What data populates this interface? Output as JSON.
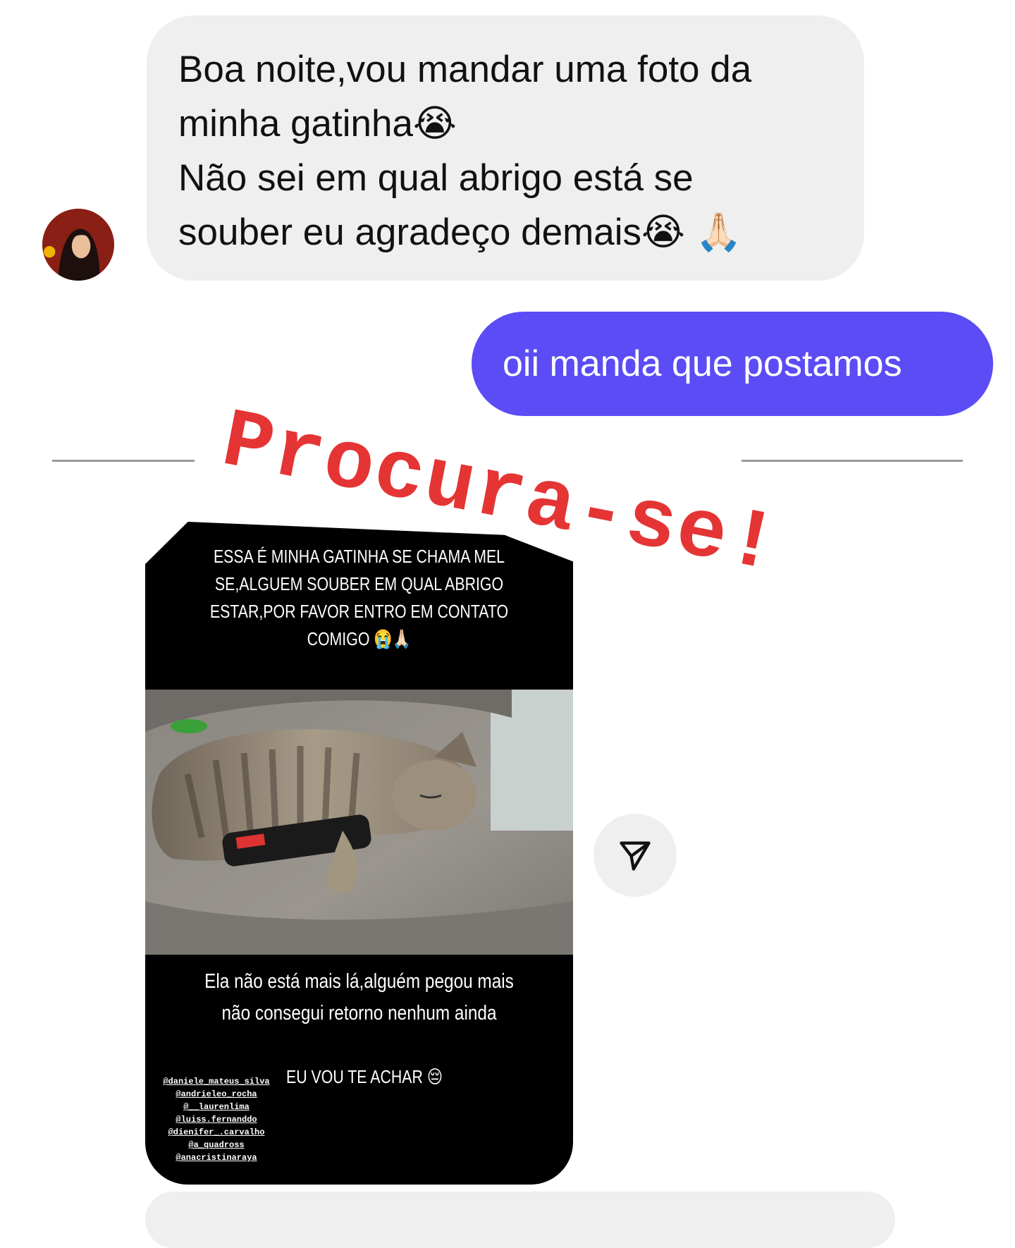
{
  "incoming_message": {
    "text": "Boa noite,vou mandar uma foto da\nminha gatinha😭\nNão sei em qual abrigo está se\nsouber eu agradeço demais😭 🙏🏻"
  },
  "outgoing_message": {
    "text": "oii manda que postamos"
  },
  "overlay_title": "Procura-se!",
  "story": {
    "top_text": "ESSA É MINHA GATINHA SE CHAMA MEL\nSE,ALGUEM SOUBER EM QUAL ABRIGO\nESTAR,POR FAVOR ENTRO EM CONTATO\nCOMIGO 😭🙏🏻",
    "middle_text": "Ela não está mais lá,alguém pegou mais\nnão consegui retorno nenhum ainda",
    "bottom_text": "EU VOU TE ACHAR 😔",
    "mentions": [
      "@daniele_mateus_silva",
      "@andrieleo_rocha",
      "@__laurenlima",
      "@luiss.fernanddo",
      "@dienifer_.carvalho",
      "@a_quadross",
      "@anacristinaraya"
    ]
  },
  "icons": {
    "share": "send-icon",
    "avatar": "avatar"
  },
  "colors": {
    "incoming_bubble": "#efefef",
    "outgoing_bubble": "#5b4cf5",
    "overlay_text": "#e53434"
  }
}
